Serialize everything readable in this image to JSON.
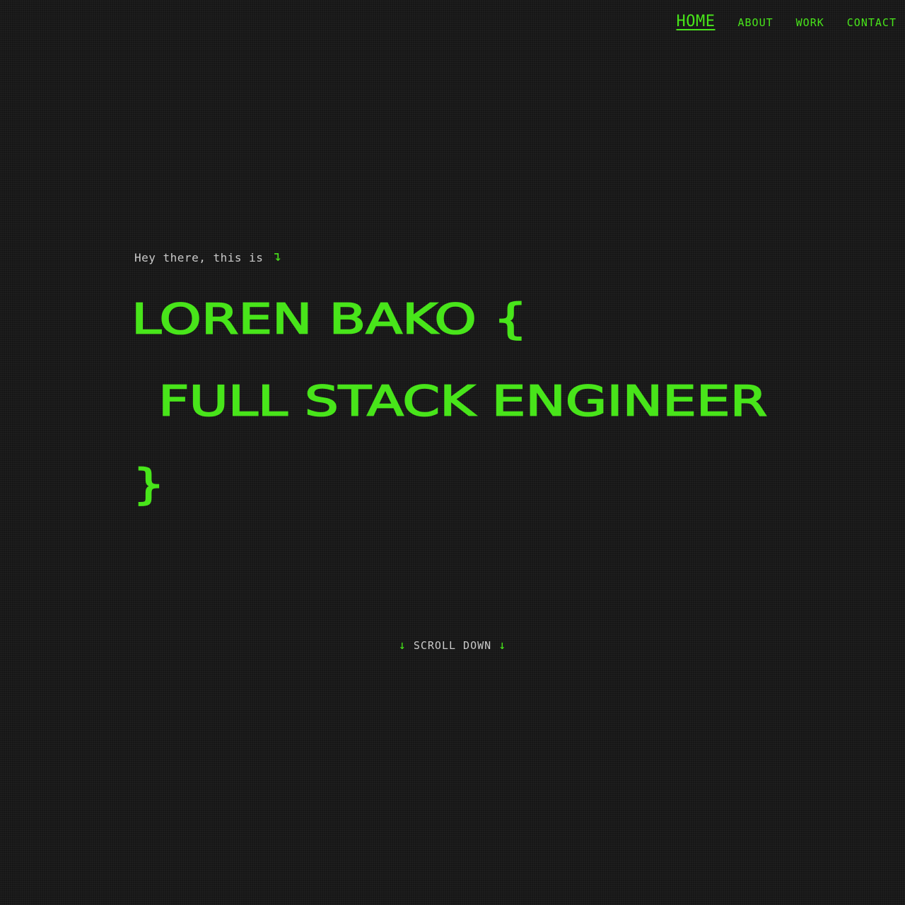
{
  "nav": {
    "items": [
      {
        "label": "HOME",
        "active": true
      },
      {
        "label": "ABOUT",
        "active": false
      },
      {
        "label": "WORK",
        "active": false
      },
      {
        "label": "CONTACT",
        "active": false
      }
    ]
  },
  "hero": {
    "intro_text": "Hey there, this is",
    "intro_icon": "↴",
    "name_line": "LOREN BAKO {",
    "title_line": "FULL STACK ENGINEER",
    "closing_brace": "}"
  },
  "scroll": {
    "label": "SCROLL DOWN",
    "arrow": "↓"
  },
  "colors": {
    "accent": "#48e51a",
    "background": "#161616",
    "text_muted": "#c9c9c9"
  },
  "icons": {
    "intro": "arrow-turn-down-icon",
    "scroll": "arrow-down-icon"
  }
}
